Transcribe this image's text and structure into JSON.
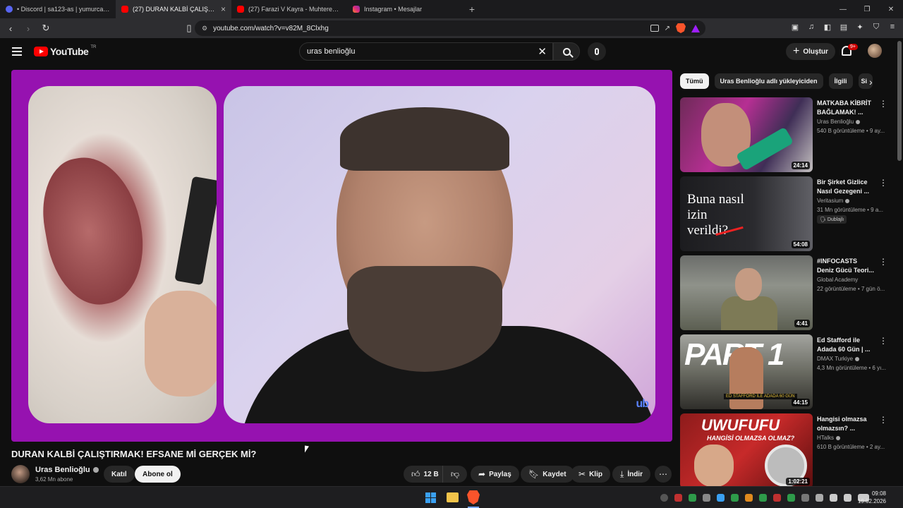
{
  "browser": {
    "tabs": [
      {
        "label": "• Discord | sa123-as | yumurcakla",
        "icon": "discord-icon",
        "active": false
      },
      {
        "label": "(27) DURAN KALBİ ÇALIŞTIRM",
        "icon": "youtube-icon",
        "active": true
      },
      {
        "label": "(27) Farazi V Kayra - Muhterem Haya",
        "icon": "youtube-icon",
        "active": false
      },
      {
        "label": "Instagram • Mesajlar",
        "icon": "instagram-icon",
        "active": false
      }
    ],
    "new_tab": "+",
    "url": "youtube.com/watch?v=v82M_8Clxhg"
  },
  "header": {
    "logo_text": "YouTube",
    "country_code": "TR",
    "search_value": "uras benlioğlu",
    "create_label": "Oluştur",
    "notification_count": "9+"
  },
  "video": {
    "title": "DURAN KALBİ ÇALIŞTIRMAK! EFSANE Mİ GERÇEK Mİ?",
    "watermark": "ub",
    "channel": "Uras Benlioğlu",
    "subscribers": "3,62 Mn abone",
    "join_label": "Katıl",
    "subscribe_label": "Abone ol",
    "like_count": "12 B",
    "share_label": "Paylaş",
    "save_label": "Kaydet",
    "clip_label": "Klip",
    "download_label": "İndir"
  },
  "chips": [
    "Tümü",
    "Uras Benlioğlu adlı yükleyiciden",
    "İlgili",
    "Si"
  ],
  "recommendations": [
    {
      "title": "MATKABA KİBRİT BAĞLAMAK! ...",
      "channel": "Uras Benlioğlu",
      "meta": "540 B görüntüleme • 9 ay...",
      "duration": "24:14",
      "tag": ""
    },
    {
      "title": "Bir Şirket Gizlice Nasıl Gezegeni ...",
      "channel": "Veritasium",
      "meta": "31 Mn görüntüleme • 9 a...",
      "duration": "54:08",
      "tag": "Dublajlı",
      "thumb_text": "Buna nasıl izin verildi?"
    },
    {
      "title": "#INFOCASTS Deniz Gücü Teori...",
      "channel": "Global Academy",
      "meta": "22 görüntüleme • 7 gün ö...",
      "duration": "4:41",
      "tag": ""
    },
    {
      "title": "Ed Stafford ile Adada 60 Gün | ...",
      "channel": "DMAX Turkiye",
      "meta": "4,3 Mn görüntüleme • 6 yı...",
      "duration": "44:15",
      "tag": "",
      "thumb_text": "PART 1",
      "thumb_caption": "ED STAFFORD İLE ADADA 60 GÜN"
    },
    {
      "title": "Hangisi olmazsa olmazsın? ...",
      "channel": "HTalks",
      "meta": "610 B görüntüleme • 2 ay...",
      "duration": "1:02:21",
      "tag": "",
      "thumb_text": "UWUFUFU",
      "thumb_caption": "HANGİSİ OLMAZSA OLMAZ?"
    }
  ],
  "taskbar": {
    "time": "09:08",
    "date": "19.02.2026"
  },
  "colors": {
    "player_border": "#9612b0",
    "yt_red": "#ff0000",
    "page_bg": "#0f0f0f"
  }
}
